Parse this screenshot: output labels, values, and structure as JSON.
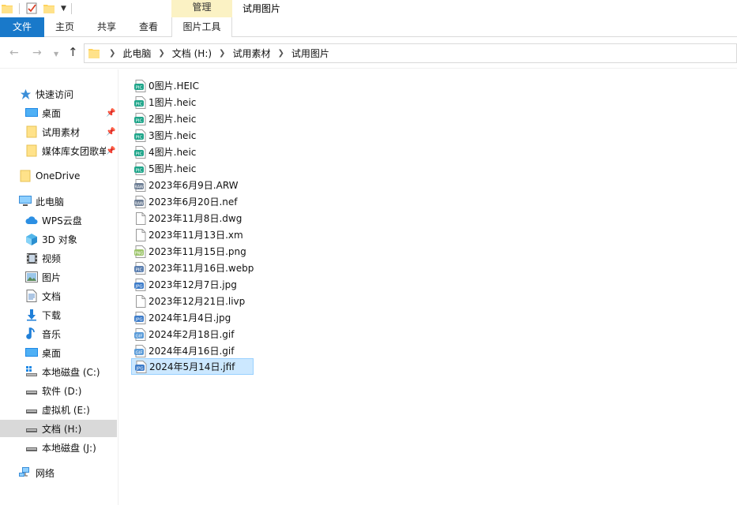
{
  "window": {
    "title": "试用图片",
    "context_tab": "管理"
  },
  "ribbon": {
    "tabs": [
      {
        "label": "文件"
      },
      {
        "label": "主页"
      },
      {
        "label": "共享"
      },
      {
        "label": "查看"
      },
      {
        "label": "图片工具"
      }
    ]
  },
  "address": {
    "crumbs": [
      "此电脑",
      "文档 (H:)",
      "试用素材",
      "试用图片"
    ]
  },
  "nav": {
    "quick_access": "快速访问",
    "pinned": [
      {
        "label": "桌面",
        "icon": "desktop-icon"
      },
      {
        "label": "试用素材",
        "icon": "folder-icon"
      },
      {
        "label": "媒体库女团歌单",
        "icon": "folder-icon"
      }
    ],
    "onedrive": "OneDrive",
    "this_pc": "此电脑",
    "pc_items": [
      {
        "label": "WPS云盘",
        "icon": "cloud-icon"
      },
      {
        "label": "3D 对象",
        "icon": "cube-icon"
      },
      {
        "label": "视频",
        "icon": "video-icon"
      },
      {
        "label": "图片",
        "icon": "picture-icon"
      },
      {
        "label": "文档",
        "icon": "document-icon"
      },
      {
        "label": "下载",
        "icon": "download-icon"
      },
      {
        "label": "音乐",
        "icon": "music-icon"
      },
      {
        "label": "桌面",
        "icon": "desktop-icon"
      },
      {
        "label": "本地磁盘 (C:)",
        "icon": "windows-drive-icon"
      },
      {
        "label": "软件 (D:)",
        "icon": "drive-icon"
      },
      {
        "label": "虚拟机 (E:)",
        "icon": "drive-icon"
      },
      {
        "label": "文档 (H:)",
        "icon": "drive-icon"
      },
      {
        "label": "本地磁盘 (J:)",
        "icon": "drive-icon"
      }
    ],
    "network": "网络",
    "selected": "文档 (H:)"
  },
  "files": [
    {
      "name": "0图片.HEIC",
      "icon": "pic-teal"
    },
    {
      "name": "1图片.heic",
      "icon": "pic-teal"
    },
    {
      "name": "2图片.heic",
      "icon": "pic-teal"
    },
    {
      "name": "3图片.heic",
      "icon": "pic-teal"
    },
    {
      "name": "4图片.heic",
      "icon": "pic-teal"
    },
    {
      "name": "5图片.heic",
      "icon": "pic-teal"
    },
    {
      "name": "2023年6月9日.ARW",
      "icon": "raw"
    },
    {
      "name": "2023年6月20日.nef",
      "icon": "raw"
    },
    {
      "name": "2023年11月8日.dwg",
      "icon": "blank"
    },
    {
      "name": "2023年11月13日.xm",
      "icon": "blank"
    },
    {
      "name": "2023年11月15日.png",
      "icon": "png"
    },
    {
      "name": "2023年11月16日.webp",
      "icon": "webp"
    },
    {
      "name": "2023年12月7日.jpg",
      "icon": "jpg"
    },
    {
      "name": "2023年12月21日.livp",
      "icon": "blank"
    },
    {
      "name": "2024年1月4日.jpg",
      "icon": "jpg"
    },
    {
      "name": "2024年2月18日.gif",
      "icon": "gif"
    },
    {
      "name": "2024年4月16日.gif",
      "icon": "gif"
    },
    {
      "name": "2024年5月14日.jfif",
      "icon": "jpg"
    }
  ],
  "selected_file": "2024年5月14日.jfif",
  "colors": {
    "accent": "#1979ca",
    "context_tab_bg": "#fbf2c4",
    "selection_bg": "#cce8ff",
    "selection_border": "#99d1ff",
    "nav_selected": "#d9d9d9",
    "pic_teal": "#1fa58a",
    "jpg_blue": "#3d7cc9"
  }
}
